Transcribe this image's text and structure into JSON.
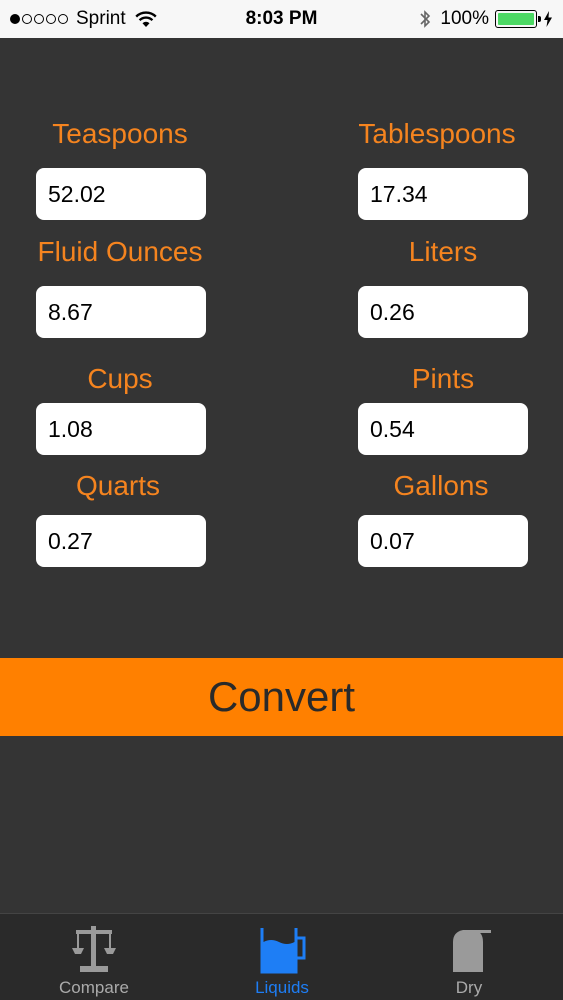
{
  "status_bar": {
    "carrier": "Sprint",
    "time": "8:03 PM",
    "battery_percent": "100%",
    "signal_bars_filled": 1,
    "signal_bars_total": 5
  },
  "fields": [
    {
      "label": "Teaspoons",
      "value": "52.02"
    },
    {
      "label": "Tablespoons",
      "value": "17.34"
    },
    {
      "label": "Fluid Ounces",
      "value": "8.67"
    },
    {
      "label": "Liters",
      "value": "0.26"
    },
    {
      "label": "Cups",
      "value": "1.08"
    },
    {
      "label": "Pints",
      "value": "0.54"
    },
    {
      "label": "Quarts",
      "value": "0.27"
    },
    {
      "label": "Gallons",
      "value": "0.07"
    }
  ],
  "convert_label": "Convert",
  "tabs": [
    {
      "label": "Compare",
      "icon": "scale-icon",
      "active": false
    },
    {
      "label": "Liquids",
      "icon": "liquid-measuring-cup-icon",
      "active": true
    },
    {
      "label": "Dry",
      "icon": "dry-canister-icon",
      "active": false
    }
  ],
  "colors": {
    "background": "#343434",
    "label_orange": "#f5841f",
    "button_orange": "#ff8000",
    "tab_active": "#1e7ef5",
    "tab_inactive": "#999999"
  }
}
